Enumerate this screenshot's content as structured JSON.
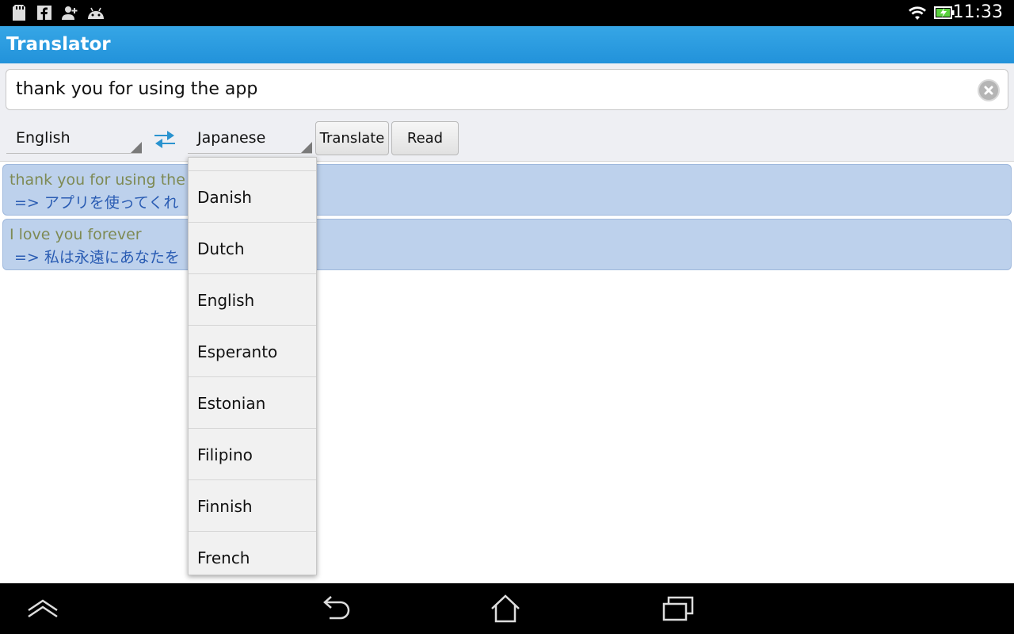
{
  "status_bar": {
    "icons_left": [
      "sd-card-icon",
      "facebook-icon",
      "add-person-icon",
      "android-icon"
    ],
    "icons_right": [
      "wifi-icon",
      "battery-charging-icon"
    ],
    "time": "11:33"
  },
  "app": {
    "title": "Translator"
  },
  "input": {
    "value": "thank you for using the app"
  },
  "controls": {
    "source_language": "English",
    "target_language": "Japanese",
    "translate_label": "Translate",
    "read_label": "Read"
  },
  "history": [
    {
      "source": "thank you for using the a",
      "translation": "=> アプリを使ってくれ"
    },
    {
      "source": "I love you forever",
      "translation": "=> 私は永遠にあなたを"
    }
  ],
  "dropdown": {
    "options": [
      "Danish",
      "Dutch",
      "English",
      "Esperanto",
      "Estonian",
      "Filipino",
      "Finnish",
      "French"
    ]
  },
  "nav_bar": {
    "buttons": [
      "up-icon",
      "back-icon",
      "home-icon",
      "recent-apps-icon"
    ]
  },
  "colors": {
    "action_bar": "#2a9be0",
    "history_bg": "#bdd1ec",
    "source_text": "#7e8a54",
    "translation_text": "#2a5cb3"
  }
}
